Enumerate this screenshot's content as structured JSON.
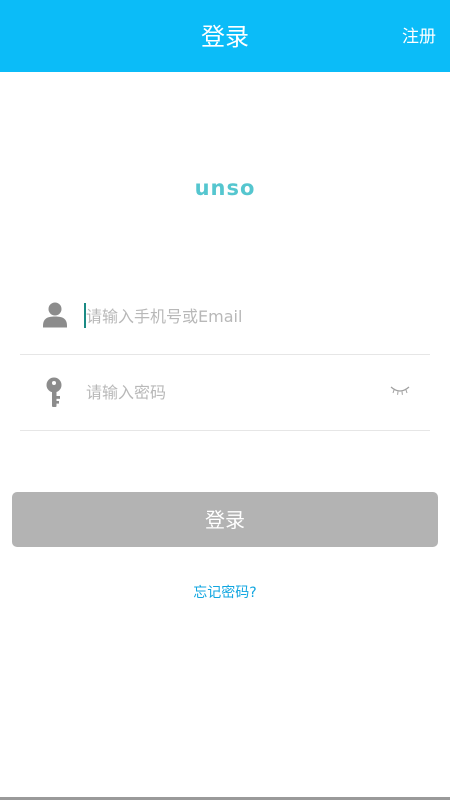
{
  "header": {
    "title": "登录",
    "register_label": "注册",
    "bg_color": "#0bbcf8"
  },
  "logo": {
    "text": "unso",
    "color": "#55c6cf"
  },
  "form": {
    "account": {
      "icon": "user-icon",
      "placeholder": "请输入手机号或Email",
      "value": ""
    },
    "password": {
      "icon": "key-icon",
      "placeholder": "请输入密码",
      "value": "",
      "toggle_icon": "eye-closed-icon"
    }
  },
  "login_button": {
    "label": "登录",
    "bg_color": "#b3b3b3"
  },
  "forgot_password": {
    "label": "忘记密码?",
    "color": "#11a6e0"
  }
}
